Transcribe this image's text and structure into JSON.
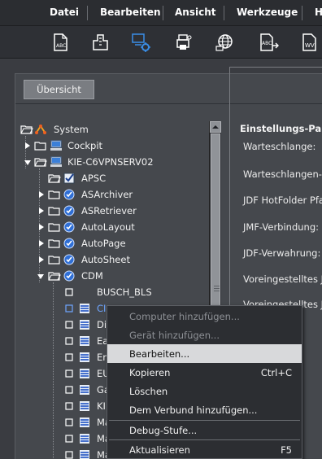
{
  "menu": {
    "items": [
      "Datei",
      "Bearbeiten",
      "Ansicht",
      "Werkzeuge",
      "H"
    ]
  },
  "toolbar": {
    "buttons": [
      "abc-document-icon",
      "building-icon",
      "server-settings-icon",
      "printer-settings-icon",
      "network-globe-icon",
      "abc-arrow-icon",
      "wv-document-icon"
    ]
  },
  "tabs": {
    "overview": "Übersicht"
  },
  "tree": {
    "root": "System",
    "cockpit": "Cockpit",
    "server": "KIE-C6VPNSERV02",
    "apsc": "APSC",
    "asarchiver": "ASArchiver",
    "asretriever": "ASRetriever",
    "autolayout": "AutoLayout",
    "autopage": "AutoPage",
    "autosheet": "AutoSheet",
    "cdm": "CDM",
    "busch": "BUSCH_BLS",
    "selected_partial": "CI",
    "partial": [
      "Di",
      "Ea",
      "En",
      "EU",
      "Ga",
      "KI",
      "Ma",
      "Ma",
      "Ma"
    ]
  },
  "settings": {
    "title": "Einstellungs-Para",
    "labels": [
      "Warteschlange:",
      "Warteschlangen-I",
      "JDF HotFolder Pfa",
      "JMF-Verbindung:",
      "JDF-Verwahrung:",
      "Voreingestelltes J",
      "Voreingestelltes J"
    ]
  },
  "context_menu": {
    "items": [
      {
        "label": "Computer hinzufügen...",
        "enabled": false
      },
      {
        "label": "Gerät hinzufügen...",
        "enabled": false
      },
      {
        "label": "Bearbeiten...",
        "enabled": true,
        "highlighted": true
      },
      {
        "label": "Kopieren",
        "shortcut": "Ctrl+C",
        "enabled": true
      },
      {
        "label": "Löschen",
        "enabled": true
      },
      {
        "label": "Dem Verbund hinzufügen...",
        "enabled": true
      },
      {
        "label": "Debug-Stufe...",
        "enabled": true
      },
      {
        "label": "Aktualisieren",
        "shortcut": "F5",
        "enabled": true
      }
    ]
  },
  "colors": {
    "background": "#3c3f44",
    "menubar": "#2b2d31",
    "selected_text": "#6fa6ff",
    "menu_highlight": "#d8d9db",
    "accent_icon": "#2f6fd6"
  }
}
